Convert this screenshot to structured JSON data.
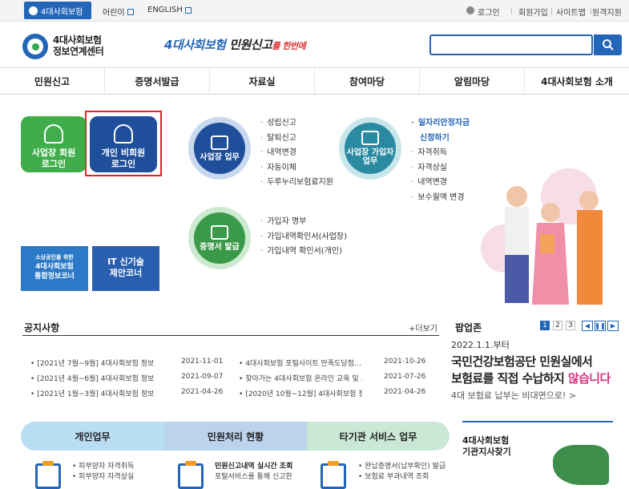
{
  "topbar": {
    "main_tab": "4대사회보험",
    "links": [
      "어린이",
      "ENGLISH"
    ],
    "utility": [
      "로그인",
      "회원가입",
      "사이트맵",
      "원격지원"
    ]
  },
  "header": {
    "logo_line1": "4대사회보험",
    "logo_line2": "정보연계센터",
    "slogan_a": "4대사회보험",
    "slogan_b": " 민원신고",
    "slogan_c": "를 한번에"
  },
  "gnb": [
    "민원신고",
    "증명서발급",
    "자료실",
    "참여마당",
    "알림마당",
    "4대사회보험 소개"
  ],
  "login": {
    "business_line1": "사업장 회원",
    "business_line2": "로그인",
    "personal_line1": "개인 비회원",
    "personal_line2": "로그인"
  },
  "banners": {
    "smb_line1": "소상공인을 위한",
    "smb_line2": "4대사회보험",
    "smb_line3": "통합정보코너",
    "it_line1": "IT 신기술",
    "it_line2": "제안코너"
  },
  "services": {
    "workplace_label": "사업장 업무",
    "workplace_items": [
      "성립신고",
      "탈퇴신고",
      "내역변경",
      "자동이체",
      "두루누리보험료지원"
    ],
    "subscriber_label_1": "사업장 가입자",
    "subscriber_label_2": "업무",
    "subscriber_hl_1": "일자리안정자금",
    "subscriber_hl_2": "신청하기",
    "subscriber_items": [
      "자격취득",
      "자격상실",
      "내역변경",
      "보수월액 변경"
    ],
    "cert_label": "증명서 발급",
    "cert_items": [
      "가입자 명부",
      "가입내역확인서(사업장)",
      "가입내역 확인서(개인)"
    ]
  },
  "notice": {
    "title": "공지사항",
    "more": "+더보기",
    "rows": [
      {
        "left_title": "[2021년 7월~9월] 4대사회보험 정보…",
        "left_date": "2021-11-01",
        "right_title": "4대사회보험 포털사이트 만족도당첨…",
        "right_date": "2021-10-26"
      },
      {
        "left_title": "[2021년 4월~6월] 4대사회보험 정보…",
        "left_date": "2021-09-07",
        "right_title": "찾아가는 4대사회보험 온라인 교육 및 …",
        "right_date": "2021-07-26"
      },
      {
        "left_title": "[2021년 1월~3월] 4대사회보험 정보…",
        "left_date": "2021-04-26",
        "right_title": "[2020년 10월~12월] 4대사회보험 정보…",
        "right_date": "2021-04-26"
      }
    ]
  },
  "popup": {
    "title": "팝업존",
    "pages": [
      "1",
      "2",
      "3"
    ],
    "date": "2022.1.1.부터",
    "headline_1": "국민건강보험공단 민원실에서",
    "headline_2a": "보험료를 직접 수납하지 ",
    "headline_2b": "않습니다",
    "sub": "4대 보험료 납부는 비대면으로! >"
  },
  "bottom_tabs": [
    "개인업무",
    "민원처리 현황",
    "타기관 서비스 업무"
  ],
  "bottom": {
    "personal_items": [
      "피부양자 자격취득",
      "피부양자 자격상실"
    ],
    "status_title": "민원신고내역 실시간 조회",
    "status_sub": "포털서비스를 통해 신고한",
    "other_items": [
      "완납증명서(납부확인) 발급",
      "보험료 부과내역 조회"
    ],
    "region_title_1": "4대사회보험",
    "region_title_2": "기관지사찾기"
  },
  "colors": {
    "brand_blue": "#2366b8",
    "green": "#2fa84f",
    "pink": "#d3347f"
  }
}
